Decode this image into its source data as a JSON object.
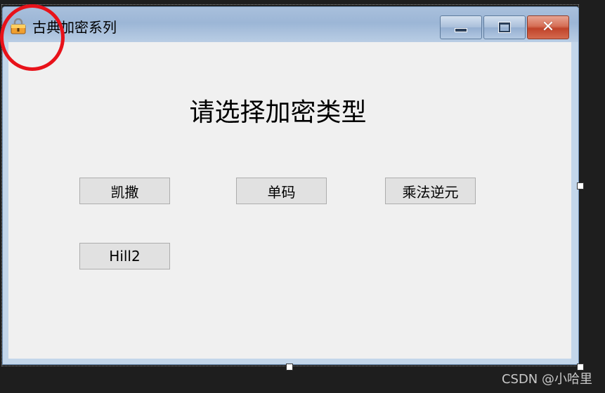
{
  "window": {
    "title": "古典加密系列",
    "app_icon": "padlock-folder-icon",
    "controls": {
      "minimize_icon": "minimize-icon",
      "maximize_icon": "maximize-icon",
      "close_icon": "close-icon",
      "close_glyph": "✕"
    }
  },
  "form": {
    "heading": "请选择加密类型",
    "buttons": {
      "caesar": "凯撒",
      "monoalphabetic": "单码",
      "multiplicative_inverse": "乘法逆元",
      "hill2": "Hill2"
    }
  },
  "annotation": {
    "highlight_color": "#e8121a"
  },
  "watermark": "CSDN @小哈里",
  "colors": {
    "close_button": "#c0432a",
    "titlebar": "#9cb6d6",
    "client_background": "#f0f0f0",
    "button_background": "#e1e1e1"
  }
}
